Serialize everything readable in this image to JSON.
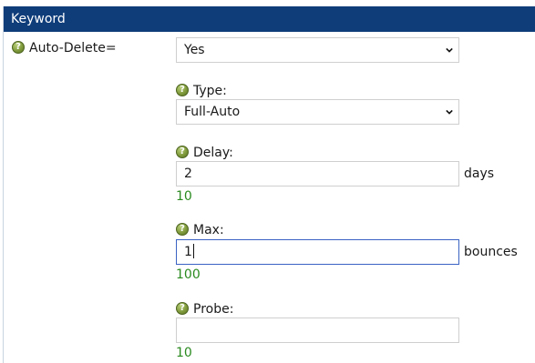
{
  "header": {
    "title": "Keyword"
  },
  "auto_delete": {
    "label": "Auto-Delete=",
    "selected": "Yes"
  },
  "type": {
    "label": "Type:",
    "selected": "Full-Auto"
  },
  "delay": {
    "label": "Delay:",
    "value": "2",
    "unit": "days",
    "hint": "10"
  },
  "max": {
    "label": "Max:",
    "value": "1",
    "unit": "bounces",
    "hint": "100"
  },
  "probe": {
    "label": "Probe:",
    "value": "",
    "hint": "10"
  },
  "icons": {
    "help": "help-question-icon",
    "dropdown": "chevron-down-icon"
  },
  "colors": {
    "header_bg": "#0f3d7a",
    "hint_text": "#2a8a1f",
    "focus_border": "#3a62c4"
  }
}
